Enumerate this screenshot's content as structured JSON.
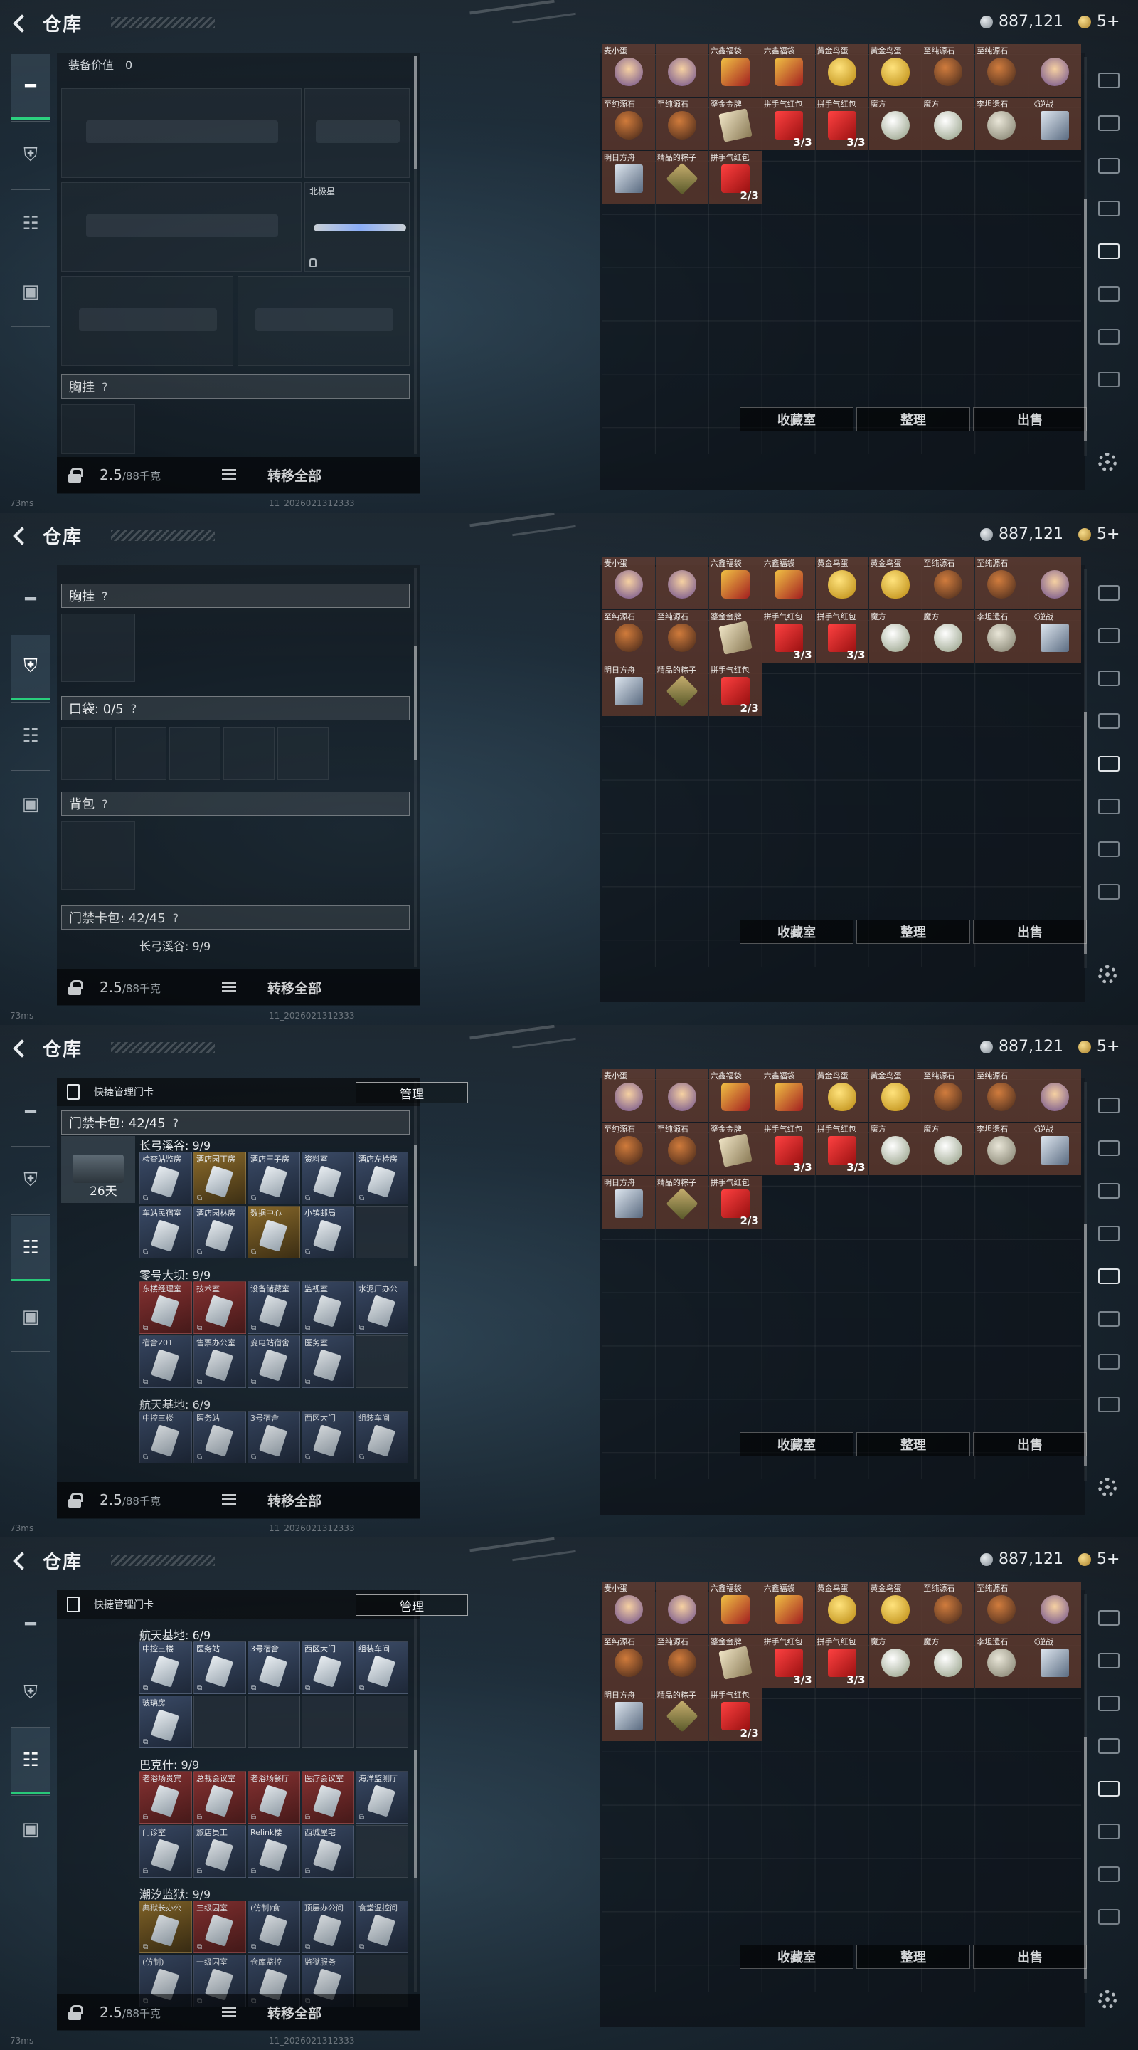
{
  "header": {
    "title": "仓库",
    "currency": "887,121",
    "coupons": "5+"
  },
  "bottom": {
    "weight_value": "2.5",
    "weight_unit": "/88千克",
    "transfer_all": "转移全部"
  },
  "storage": {
    "buttons": {
      "collection": "收藏室",
      "sort": "整理",
      "sell": "出售"
    },
    "items": [
      {
        "label": "麦小蛋",
        "count": "",
        "color": "brown",
        "art": "doll"
      },
      {
        "label": "",
        "count": "",
        "color": "brown",
        "art": "doll"
      },
      {
        "label": "六鑫福袋",
        "count": "",
        "color": "brown",
        "art": "bag"
      },
      {
        "label": "六鑫福袋",
        "count": "",
        "color": "brown",
        "art": "bag"
      },
      {
        "label": "黄金鸟蛋",
        "count": "",
        "color": "brown",
        "art": "egg"
      },
      {
        "label": "黄金鸟蛋",
        "count": "",
        "color": "brown",
        "art": "egg"
      },
      {
        "label": "至纯源石",
        "count": "",
        "color": "brown",
        "art": "stone"
      },
      {
        "label": "至纯源石",
        "count": "",
        "color": "brown",
        "art": "stone"
      },
      {
        "label": "",
        "count": "",
        "color": "brown",
        "art": "doll"
      },
      {
        "label": "至纯源石",
        "count": "",
        "color": "brown",
        "art": "stone"
      },
      {
        "label": "至纯源石",
        "count": "",
        "color": "brown",
        "art": "stone"
      },
      {
        "label": "鎏金金牌",
        "count": "",
        "color": "brown",
        "art": "paper"
      },
      {
        "label": "拼手气红包",
        "count": "3/3",
        "color": "brown",
        "art": "env"
      },
      {
        "label": "拼手气红包",
        "count": "3/3",
        "color": "brown",
        "art": "env"
      },
      {
        "label": "魔方",
        "count": "",
        "color": "brown",
        "art": "ball"
      },
      {
        "label": "魔方",
        "count": "",
        "color": "brown",
        "art": "ball"
      },
      {
        "label": "李坦遗石",
        "count": "",
        "color": "brown",
        "art": "moon"
      },
      {
        "label": "《逆战",
        "count": "",
        "color": "brown",
        "art": "pic"
      },
      {
        "label": "明日方舟",
        "count": "",
        "color": "brown",
        "art": "pic"
      },
      {
        "label": "精品的粽子",
        "count": "",
        "color": "brown",
        "art": "zong"
      },
      {
        "label": "拼手气红包",
        "count": "2/3",
        "color": "brown",
        "art": "env"
      }
    ]
  },
  "gear_panel": {
    "equip_value_label": "装备价值",
    "equip_value": "0",
    "knife_name": "北极星",
    "chest_label": "胸挂",
    "pocket_label": "口袋: 0/5",
    "backpack_label": "背包",
    "keycard_label": "门禁卡包: 42/45",
    "help": "?"
  },
  "card_panel": {
    "quick_manage": "快捷管理门卡",
    "manage_btn": "管理",
    "keycard_label": "门禁卡包: 42/45",
    "days": "26天",
    "groups": [
      {
        "name": "长弓溪谷: 9/9",
        "cards": [
          {
            "l": "检查站监房",
            "c": "blue"
          },
          {
            "l": "酒店园丁房",
            "c": "gold"
          },
          {
            "l": "酒店王子房",
            "c": "blue"
          },
          {
            "l": "资料室",
            "c": "blue"
          },
          {
            "l": "酒店左检房",
            "c": "blue"
          },
          {
            "l": "车站民宿室",
            "c": "blue"
          },
          {
            "l": "酒店园林房",
            "c": "blue"
          },
          {
            "l": "数据中心",
            "c": "gold"
          },
          {
            "l": "小镇邮局",
            "c": "blue"
          }
        ]
      },
      {
        "name": "零号大坝: 9/9",
        "cards": [
          {
            "l": "东楼经理室",
            "c": "red"
          },
          {
            "l": "技术室",
            "c": "red"
          },
          {
            "l": "设备储藏室",
            "c": "blue"
          },
          {
            "l": "监视室",
            "c": "blue"
          },
          {
            "l": "水泥厂办公",
            "c": "blue"
          },
          {
            "l": "宿舍201",
            "c": "blue"
          },
          {
            "l": "售票办公室",
            "c": "blue"
          },
          {
            "l": "变电站宿舍",
            "c": "blue"
          },
          {
            "l": "医务室",
            "c": "blue"
          }
        ]
      },
      {
        "name": "航天基地: 6/9",
        "cards": [
          {
            "l": "中控三楼",
            "c": "blue"
          },
          {
            "l": "医务站",
            "c": "blue"
          },
          {
            "l": "3号宿舍",
            "c": "blue"
          },
          {
            "l": "西区大门",
            "c": "blue"
          },
          {
            "l": "组装车间",
            "c": "blue"
          },
          {
            "l": "玻璃房",
            "c": "blue"
          }
        ]
      },
      {
        "name": "巴克什: 9/9",
        "cards": [
          {
            "l": "老浴场贵宾",
            "c": "red"
          },
          {
            "l": "总裁会议室",
            "c": "red"
          },
          {
            "l": "老浴场餐厅",
            "c": "red"
          },
          {
            "l": "医疗会议室",
            "c": "red"
          },
          {
            "l": "海洋监测厅",
            "c": "blue"
          },
          {
            "l": "门诊室",
            "c": "blue"
          },
          {
            "l": "旅店员工",
            "c": "blue"
          },
          {
            "l": "Relink楼",
            "c": "blue"
          },
          {
            "l": "西城屋宅",
            "c": "blue"
          }
        ]
      },
      {
        "name": "潮汐监狱: 9/9",
        "cards": [
          {
            "l": "典狱长办公",
            "c": "gold"
          },
          {
            "l": "三级囚室",
            "c": "red"
          },
          {
            "l": "(仿制)食",
            "c": "blue"
          },
          {
            "l": "顶层办公间",
            "c": "blue"
          },
          {
            "l": "食堂温控间",
            "c": "blue"
          },
          {
            "l": "(仿制)",
            "c": "blue"
          },
          {
            "l": "一级囚室",
            "c": "blue"
          },
          {
            "l": "仓库监控",
            "c": "blue"
          },
          {
            "l": "监狱服务",
            "c": "blue"
          }
        ]
      }
    ]
  },
  "status": {
    "ping": "73ms",
    "build": "11_2026021312333"
  }
}
